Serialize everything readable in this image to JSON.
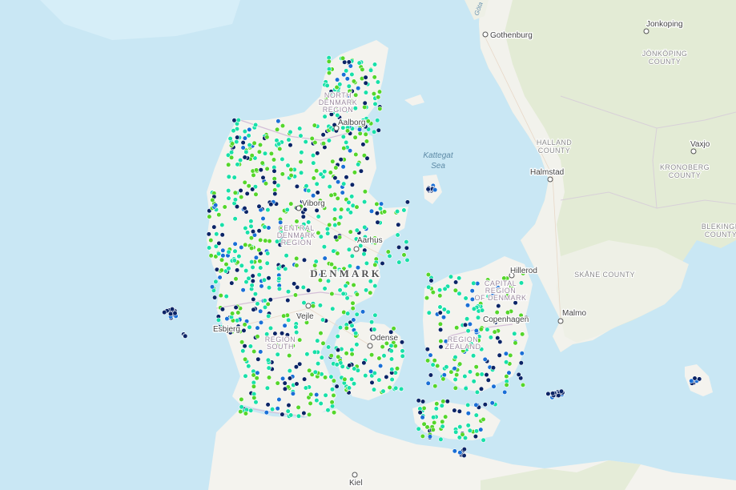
{
  "map": {
    "sea_labels": [
      {
        "name": "kattegat-sea-label",
        "lines": [
          "Kattegat",
          "Sea"
        ]
      }
    ],
    "river_label": "Göta",
    "country_label": "DENMARK",
    "cities": [
      {
        "name": "Gothenburg",
        "label": "Gothenburg"
      },
      {
        "name": "Jonkoping",
        "label": "Jonkoping"
      },
      {
        "name": "Halmstad",
        "label": "Halmstad"
      },
      {
        "name": "Vaxjo",
        "label": "Vaxjo"
      },
      {
        "name": "Aalborg",
        "label": "Aalborg"
      },
      {
        "name": "Viborg",
        "label": "Viborg"
      },
      {
        "name": "Aarhus",
        "label": "Aarhus"
      },
      {
        "name": "Vejle",
        "label": "Vejle"
      },
      {
        "name": "Esbjerg",
        "label": "Esbjerg"
      },
      {
        "name": "Odense",
        "label": "Odense"
      },
      {
        "name": "Hillerod",
        "label": "Hillerod"
      },
      {
        "name": "Copenhagen",
        "label": "Copenhagen"
      },
      {
        "name": "Malmo",
        "label": "Malmo"
      },
      {
        "name": "Kiel",
        "label": "Kiel"
      }
    ],
    "county_labels": [
      {
        "lines": [
          "JÖNKÖPING",
          "COUNTY"
        ]
      },
      {
        "lines": [
          "HALLAND",
          "COUNTY"
        ]
      },
      {
        "lines": [
          "KRONOBERG",
          "COUNTY"
        ]
      },
      {
        "lines": [
          "BLEKINGE",
          "COUNTY"
        ]
      },
      {
        "lines": [
          "SKÅNE COUNTY"
        ]
      }
    ],
    "region_labels": [
      {
        "lines": [
          "NORTH",
          "DENMARK",
          "REGION"
        ]
      },
      {
        "lines": [
          "CENTRAL",
          "DENMARK",
          "REGION"
        ]
      },
      {
        "lines": [
          "REGION",
          "SOUTH"
        ]
      },
      {
        "lines": [
          "CAPITAL",
          "REGION",
          "OF DENMARK"
        ]
      },
      {
        "lines": [
          "REGION",
          "ZEALAND"
        ]
      }
    ],
    "colors": {
      "water": "#c9e7f4",
      "land": "#f4f3ee",
      "land_green": "#e4ecd6",
      "border": "#d4bfd8",
      "point_green": "#55d62a",
      "point_teal": "#18e0a8",
      "point_blue": "#1a6fd6",
      "point_navy": "#0b2466"
    },
    "point_categories": [
      "green",
      "teal",
      "blue",
      "navy"
    ]
  }
}
